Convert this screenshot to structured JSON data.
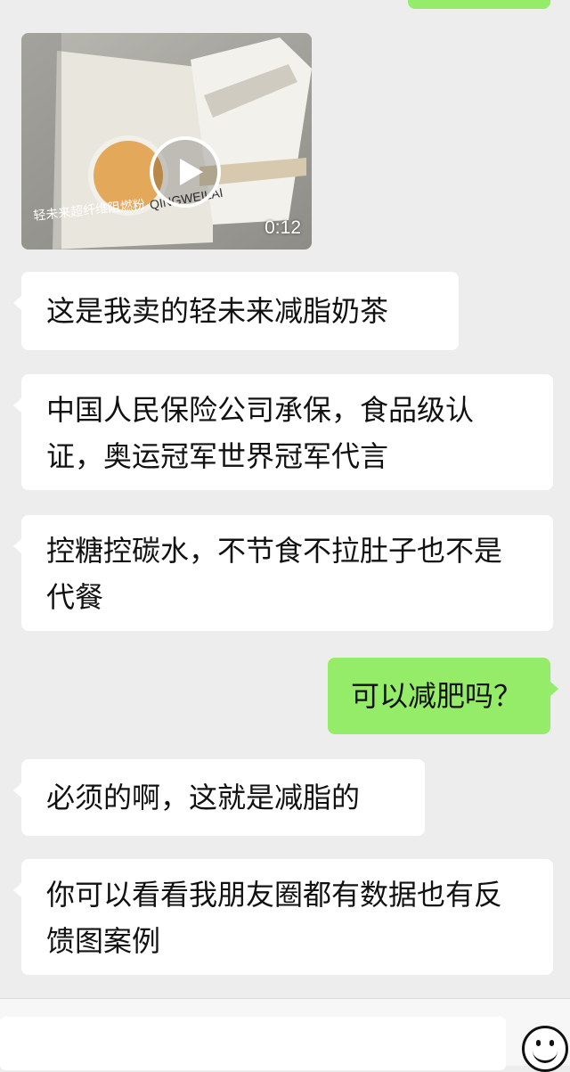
{
  "conversation": {
    "video_message": {
      "duration": "0:12",
      "thumbnail_caption": "轻未来超纤维阻燃粉",
      "thumbnail_brand": "QINGWEILAI"
    },
    "messages": [
      {
        "side": "left",
        "text": "这是我卖的轻未来减脂奶茶"
      },
      {
        "side": "left",
        "text": "中国人民保险公司承保，食品级认证，奥运冠军世界冠军代言"
      },
      {
        "side": "left",
        "text": "控糖控碳水，不节食不拉肚子也不是代餐"
      },
      {
        "side": "right",
        "text": "可以减肥吗？"
      },
      {
        "side": "left",
        "text": "必须的啊，这就是减脂的"
      },
      {
        "side": "left",
        "text": "你可以看看我朋友圈都有数据也有反馈图案例"
      }
    ]
  },
  "input_bar": {
    "emoji_icon": "smiley-face-icon"
  },
  "colors": {
    "background": "#ededed",
    "incoming_bubble": "#ffffff",
    "outgoing_bubble": "#95ec69"
  }
}
